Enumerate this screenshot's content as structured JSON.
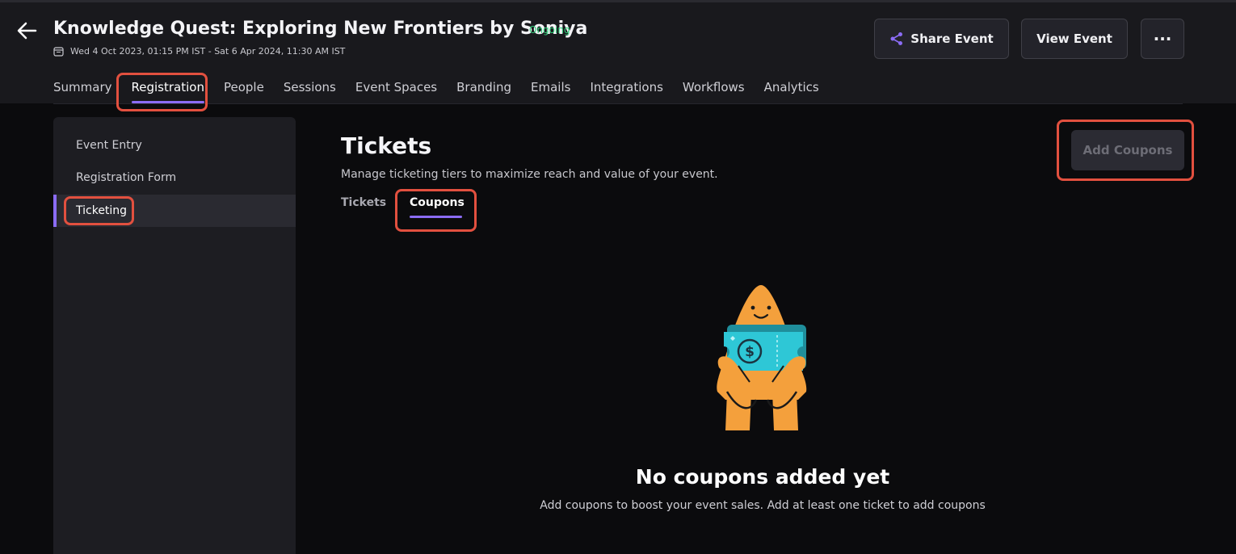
{
  "header": {
    "title": "Knowledge Quest: Exploring New Frontiers by Soniya",
    "status": "Ongoing",
    "dates": "Wed 4 Oct 2023, 01:15 PM IST - Sat 6 Apr 2024, 11:30 AM IST",
    "share_label": "Share Event",
    "view_label": "View Event",
    "more_label": "···"
  },
  "tabs": [
    {
      "label": "Summary"
    },
    {
      "label": "Registration"
    },
    {
      "label": "People"
    },
    {
      "label": "Sessions"
    },
    {
      "label": "Event Spaces"
    },
    {
      "label": "Branding"
    },
    {
      "label": "Emails"
    },
    {
      "label": "Integrations"
    },
    {
      "label": "Workflows"
    },
    {
      "label": "Analytics"
    }
  ],
  "sidebar": {
    "items": [
      {
        "label": "Event Entry"
      },
      {
        "label": "Registration Form"
      },
      {
        "label": "Ticketing"
      }
    ]
  },
  "main": {
    "title": "Tickets",
    "subtitle": "Manage ticketing tiers to maximize reach and value of your event.",
    "subtabs": [
      {
        "label": "Tickets"
      },
      {
        "label": "Coupons"
      }
    ],
    "add_button": "Add Coupons",
    "empty_title": "No coupons added yet",
    "empty_subtitle": "Add coupons to boost your event sales. Add at least one ticket to add coupons"
  },
  "colors": {
    "accent": "#8b6cf5",
    "status_green": "#2fcf7a",
    "highlight": "#e2503f",
    "mascot_orange": "#f4a03c",
    "ticket_teal": "#2ec7d6"
  }
}
